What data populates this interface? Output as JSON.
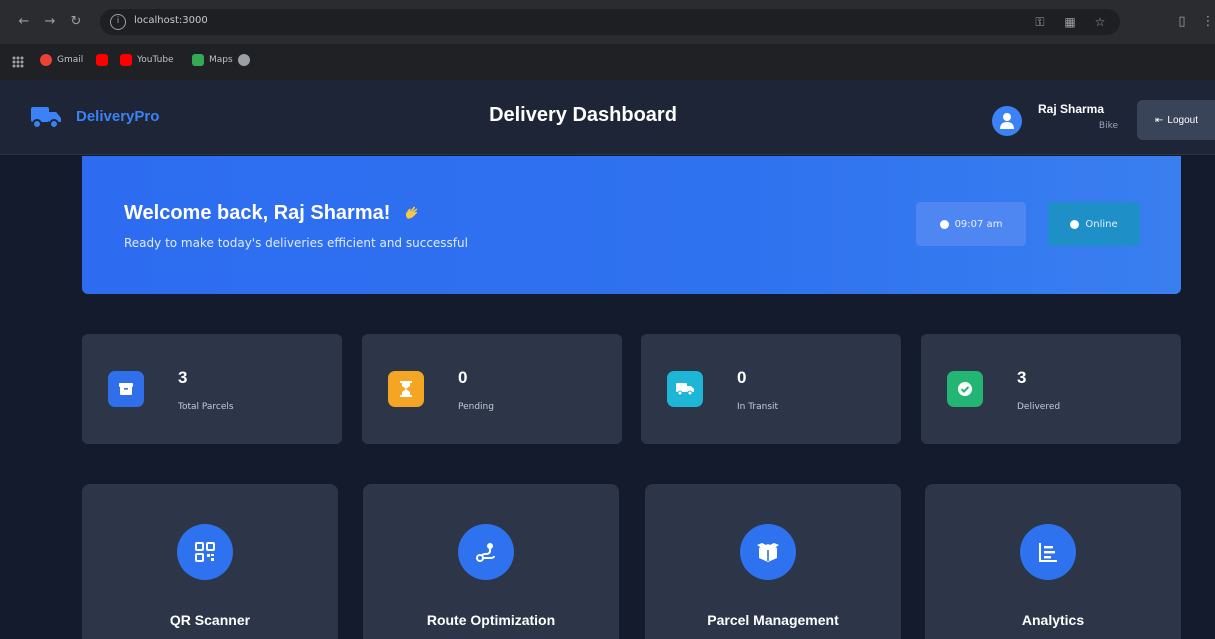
{
  "browser": {
    "url": "localhost:3000",
    "bookmarks": [
      {
        "label": "Gmail",
        "icon": "gmail-icon",
        "color": "#ea4335"
      },
      {
        "label": "",
        "icon": "youtube-icon",
        "color": "#ff0000"
      },
      {
        "label": "YouTube",
        "icon": "youtube-icon",
        "color": "#ff0000"
      },
      {
        "label": "Maps",
        "icon": "maps-icon",
        "color": "#34a853"
      },
      {
        "label": "",
        "icon": "globe-icon",
        "color": "#9aa0a6"
      }
    ]
  },
  "header": {
    "brand": "DeliveryPro",
    "title": "Delivery Dashboard",
    "user": {
      "name": "Raj Sharma",
      "role": "Bike"
    },
    "logout_label": "Logout"
  },
  "welcome": {
    "title": "Welcome back, Raj Sharma!",
    "subtitle": "Ready to make today's deliveries efficient and successful",
    "time": "09:07 am",
    "status": "Online"
  },
  "stats": [
    {
      "value": "3",
      "label": "Total Parcels",
      "icon": "box-icon",
      "color": "#2f6fea"
    },
    {
      "value": "0",
      "label": "Pending",
      "icon": "hourglass-icon",
      "color": "#f5a524"
    },
    {
      "value": "0",
      "label": "In Transit",
      "icon": "truck-icon",
      "color": "#1eb6d6"
    },
    {
      "value": "3",
      "label": "Delivered",
      "icon": "check-circle-icon",
      "color": "#22b573"
    }
  ],
  "features": [
    {
      "label": "QR Scanner",
      "icon": "qr-code-icon"
    },
    {
      "label": "Route Optimization",
      "icon": "route-icon"
    },
    {
      "label": "Parcel Management",
      "icon": "open-box-icon"
    },
    {
      "label": "Analytics",
      "icon": "chart-list-icon"
    }
  ],
  "colors": {
    "accent": "#2f72ef",
    "card": "#2d3648",
    "background": "#141b2d"
  }
}
